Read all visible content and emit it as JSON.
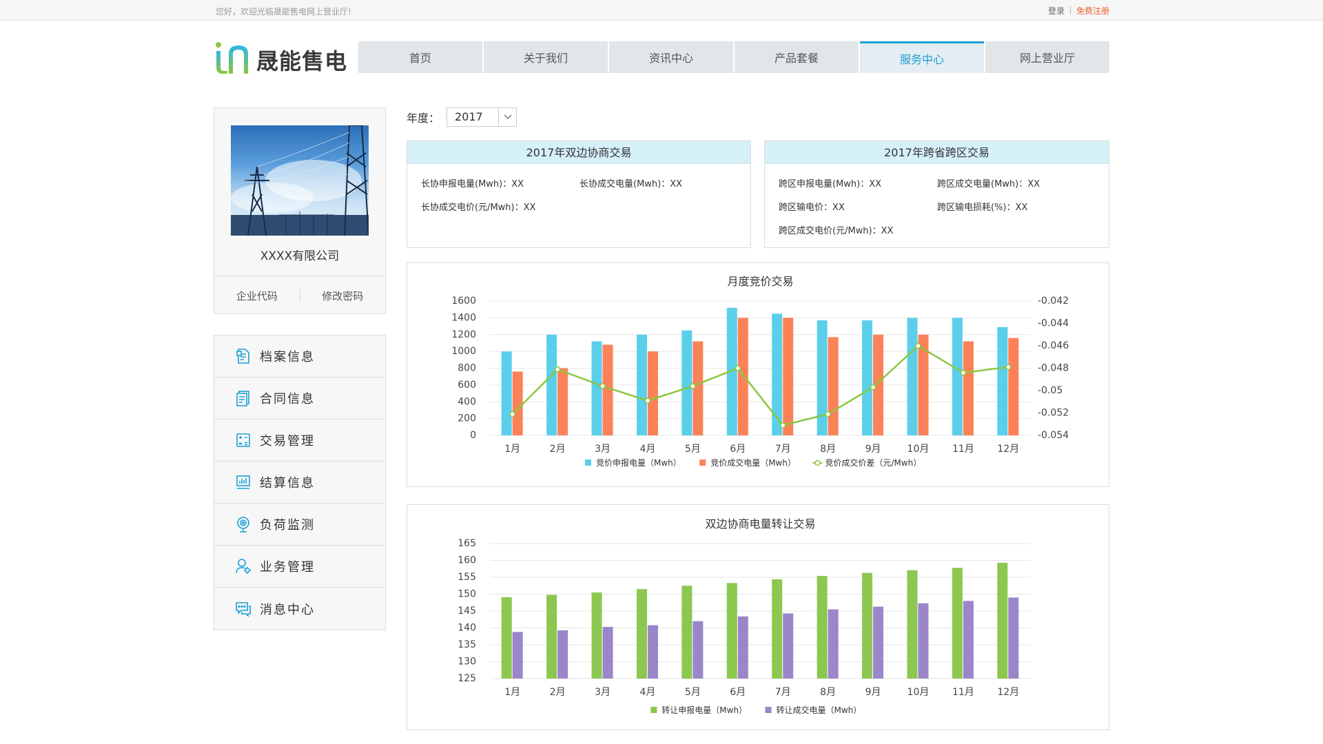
{
  "topbar": {
    "welcome": "您好，欢迎光临晟能售电网上营业厅!",
    "login": "登录",
    "register": "免费注册"
  },
  "brand": {
    "name": "晟能售电"
  },
  "nav": [
    {
      "label": "首页",
      "active": false
    },
    {
      "label": "关于我们",
      "active": false
    },
    {
      "label": "资讯中心",
      "active": false
    },
    {
      "label": "产品套餐",
      "active": false
    },
    {
      "label": "服务中心",
      "active": true
    },
    {
      "label": "网上营业厅",
      "active": false
    }
  ],
  "profile": {
    "company": "XXXX有限公司",
    "link1": "企业代码",
    "link2": "修改密码"
  },
  "menu": [
    {
      "label": "档案信息",
      "icon": "file-icon"
    },
    {
      "label": "合同信息",
      "icon": "contract-icon"
    },
    {
      "label": "交易管理",
      "icon": "calculator-icon"
    },
    {
      "label": "结算信息",
      "icon": "bar-chart-icon"
    },
    {
      "label": "负荷监测",
      "icon": "webcam-icon"
    },
    {
      "label": "业务管理",
      "icon": "user-gear-icon"
    },
    {
      "label": "消息中心",
      "icon": "chat-icon"
    }
  ],
  "year": {
    "label": "年度：",
    "value": "2017"
  },
  "bilateral": {
    "title": "2017年双边协商交易",
    "items": [
      "长协申报电量(Mwh)：XX",
      "长协成交电量(Mwh)：XX",
      "长协成交电价(元/Mwh)：XX"
    ]
  },
  "cross": {
    "title": "2017年跨省跨区交易",
    "items": [
      "跨区申报电量(Mwh)：XX",
      "跨区成交电量(Mwh)：XX",
      "跨区输电价：XX",
      "跨区输电损耗(%)：XX",
      "跨区成交电价(元/Mwh)：XX"
    ]
  },
  "chart_data": [
    {
      "type": "bar",
      "title": "月度竞价交易",
      "categories": [
        "1月",
        "2月",
        "3月",
        "4月",
        "5月",
        "6月",
        "7月",
        "8月",
        "9月",
        "10月",
        "11月",
        "12月"
      ],
      "ylim": [
        0,
        1600
      ],
      "yticks": [
        "0",
        "200",
        "400",
        "600",
        "800",
        "1000",
        "1200",
        "1400",
        "1600"
      ],
      "y2lim": [
        -0.054,
        -0.042
      ],
      "y2ticks": [
        "-0.054",
        "-0.052",
        "-0.05",
        "-0.048",
        "-0.046",
        "-0.044",
        "-0.042"
      ],
      "series": [
        {
          "name": "竞价申报电量（Mwh）",
          "type": "bar",
          "color": "#5bcfea",
          "values": [
            1000,
            1200,
            1120,
            1200,
            1250,
            1520,
            1450,
            1370,
            1370,
            1400,
            1400,
            1290
          ]
        },
        {
          "name": "竞价成交电量（Mwh）",
          "type": "bar",
          "color": "#fb8258",
          "values": [
            760,
            800,
            1080,
            1000,
            1120,
            1400,
            1400,
            1170,
            1200,
            1200,
            1120,
            1160
          ]
        },
        {
          "name": "竞价成交价差（元/Mwh）",
          "type": "line",
          "axis": "right",
          "color": "#8bc63f",
          "values": [
            -0.0521,
            -0.0481,
            -0.0496,
            -0.0509,
            -0.0496,
            -0.048,
            -0.0531,
            -0.0521,
            -0.0497,
            -0.046,
            -0.0484,
            -0.0479
          ]
        }
      ]
    },
    {
      "type": "bar",
      "title": "双边协商电量转让交易",
      "categories": [
        "1月",
        "2月",
        "3月",
        "4月",
        "5月",
        "6月",
        "7月",
        "8月",
        "9月",
        "10月",
        "11月",
        "12月"
      ],
      "ylim": [
        125,
        165
      ],
      "yticks": [
        "125",
        "130",
        "135",
        "140",
        "145",
        "150",
        "155",
        "160",
        "165"
      ],
      "series": [
        {
          "name": "转让申报电量（Mwh）",
          "color": "#8cc74f",
          "values": [
            149.1,
            149.8,
            150.5,
            151.5,
            152.5,
            153.3,
            154.4,
            155.4,
            156.3,
            157.1,
            157.8,
            159.3
          ]
        },
        {
          "name": "转让成交电量（Mwh）",
          "color": "#9a86c9",
          "values": [
            138.8,
            139.3,
            140.3,
            140.8,
            142,
            143.4,
            144.3,
            145.5,
            146.3,
            147.3,
            148,
            149
          ]
        }
      ]
    }
  ]
}
